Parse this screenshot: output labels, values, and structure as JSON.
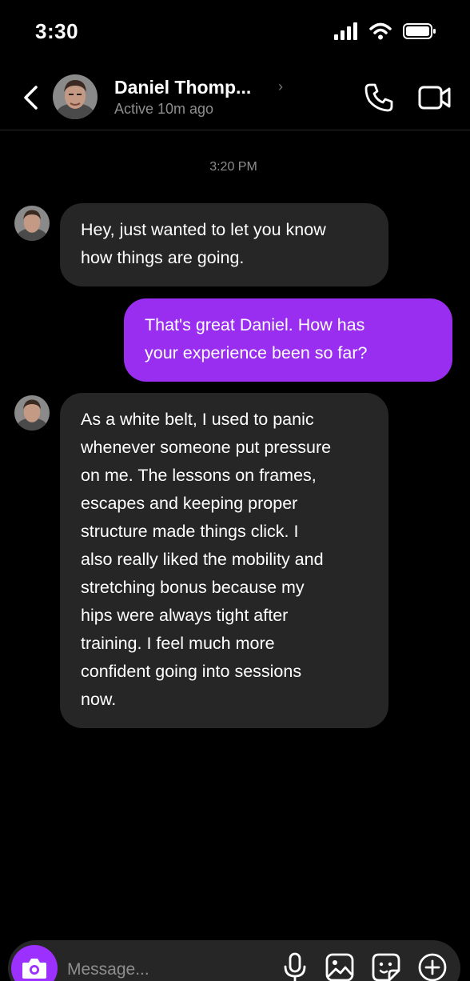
{
  "status_bar": {
    "time": "3:30",
    "battery_icon": "battery-full-icon",
    "signal_icon": "cellular-signal-icon",
    "wifi_icon": "wifi-icon"
  },
  "header": {
    "contact_name": "Daniel Thomp...",
    "contact_status": "Active 10m ago",
    "icons": [
      "back-chevron-icon",
      "phone-icon",
      "video-camera-icon"
    ]
  },
  "conversation": {
    "timestamp": "3:20 PM",
    "messages": [
      {
        "direction": "incoming",
        "text": "Hey, just wanted to let you know\nhow things are going."
      },
      {
        "direction": "outgoing",
        "text": "That's great Daniel. How has\nyour experience been so far?"
      },
      {
        "direction": "incoming",
        "text": "As a white belt, I used to panic\nwhenever someone put pressure\non me. The lessons on frames,\nescapes and keeping proper\nstructure made things click. I\nalso really liked the mobility and\nstretching bonus because my\nhips were always tight after\ntraining. I feel much more\nconfident going into sessions\nnow."
      }
    ]
  },
  "composer": {
    "placeholder": "Message...",
    "icons": [
      "camera-icon",
      "microphone-icon",
      "gallery-icon",
      "sticker-icon",
      "plus-circle-icon"
    ]
  },
  "colors": {
    "outgoing_bubble": "#9a2ef0",
    "incoming_bubble": "#262626",
    "accent": "#9b30ff",
    "background": "#000000"
  }
}
